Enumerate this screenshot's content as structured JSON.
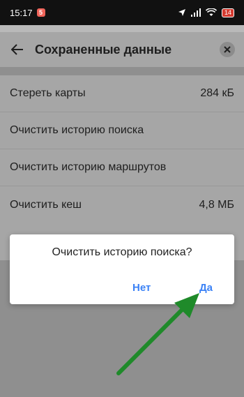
{
  "status_bar": {
    "time": "15:17",
    "notification_count": "5",
    "battery": "14"
  },
  "header": {
    "title": "Сохраненные данные",
    "back_icon": "arrow-left-icon",
    "close_icon": "close-icon"
  },
  "list": {
    "items": [
      {
        "label": "Стереть карты",
        "value": "284 кБ"
      },
      {
        "label": "Очистить историю поиска",
        "value": ""
      },
      {
        "label": "Очистить историю маршрутов",
        "value": ""
      },
      {
        "label": "Очистить кеш",
        "value": "4,8 МБ"
      }
    ]
  },
  "dialog": {
    "message": "Очистить историю поиска?",
    "no_label": "Нет",
    "yes_label": "Да"
  },
  "colors": {
    "accent": "#3b82f6",
    "arrow": "#1f8a2a"
  }
}
